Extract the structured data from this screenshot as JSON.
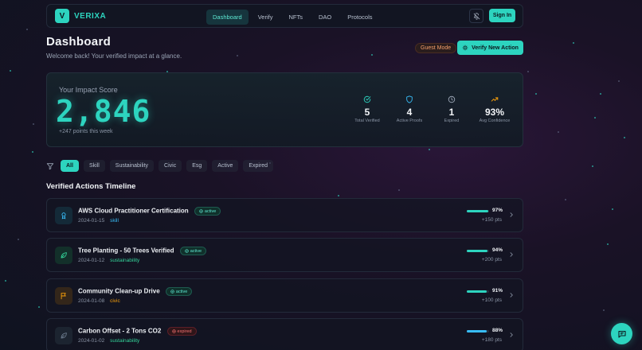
{
  "brand": {
    "logo_letter": "V",
    "name": "VERIXA",
    "accent": "#2dd4bf"
  },
  "nav": {
    "links": [
      {
        "label": "Dashboard",
        "active": true
      },
      {
        "label": "Verify",
        "active": false
      },
      {
        "label": "NFTs",
        "active": false
      },
      {
        "label": "DAO",
        "active": false
      },
      {
        "label": "Protocols",
        "active": false
      }
    ],
    "bell_icon": "bell-off-icon",
    "signin_label": "Sign In"
  },
  "header": {
    "title": "Dashboard",
    "subtitle": "Welcome back! Your verified impact at a glance.",
    "guest_badge": "Guest Mode",
    "verify_button": "Verify New Action"
  },
  "impact": {
    "label": "Your Impact Score",
    "score": "2,846",
    "delta": "+247 points this week",
    "stats": [
      {
        "icon": "check-circle-icon",
        "value": "5",
        "label": "Total Verified",
        "color": "#2dd4bf"
      },
      {
        "icon": "shield-icon",
        "value": "4",
        "label": "Active Proofs",
        "color": "#38bdf8"
      },
      {
        "icon": "clock-icon",
        "value": "1",
        "label": "Expired",
        "color": "#9aa4b5"
      },
      {
        "icon": "trending-up-icon",
        "value": "93%",
        "label": "Avg Confidence",
        "color": "#f59e0b"
      }
    ]
  },
  "filters": {
    "icon": "filter-icon",
    "chips": [
      {
        "label": "All",
        "active": true
      },
      {
        "label": "Skill",
        "active": false
      },
      {
        "label": "Sustainability",
        "active": false
      },
      {
        "label": "Civic",
        "active": false
      },
      {
        "label": "Esg",
        "active": false
      },
      {
        "label": "Active",
        "active": false
      },
      {
        "label": "Expired",
        "active": false
      }
    ]
  },
  "timeline": {
    "title": "Verified Actions Timeline",
    "items": [
      {
        "icon": "award-icon",
        "icon_color": "#38bdf8",
        "icon_bg": "#142a38",
        "title": "AWS Cloud Practitioner Certification",
        "status": "active",
        "date": "2024-01-15",
        "category": "skill",
        "category_color": "#38bdf8",
        "confidence": "97%",
        "confidence_value": 0.97,
        "bar_color": "#2dd4bf",
        "points": "+150 pts"
      },
      {
        "icon": "leaf-icon",
        "icon_color": "#34d399",
        "icon_bg": "#13302a",
        "title": "Tree Planting - 50 Trees Verified",
        "status": "active",
        "date": "2024-01-12",
        "category": "sustainability",
        "category_color": "#34d399",
        "confidence": "94%",
        "confidence_value": 0.94,
        "bar_color": "#2dd4bf",
        "points": "+200 pts"
      },
      {
        "icon": "flag-icon",
        "icon_color": "#f59e0b",
        "icon_bg": "#33261a",
        "title": "Community Clean-up Drive",
        "status": "active",
        "date": "2024-01-08",
        "category": "civic",
        "category_color": "#f59e0b",
        "confidence": "91%",
        "confidence_value": 0.91,
        "bar_color": "#2dd4bf",
        "points": "+100 pts"
      },
      {
        "icon": "leaf-icon",
        "icon_color": "#6b7a8c",
        "icon_bg": "#1c2430",
        "title": "Carbon Offset - 2 Tons CO2",
        "status": "expired",
        "date": "2024-01-02",
        "category": "sustainability",
        "category_color": "#34d399",
        "confidence": "88%",
        "confidence_value": 0.88,
        "bar_color": "#38bdf8",
        "points": "+180 pts"
      }
    ]
  },
  "chat_icon": "chat-icon"
}
